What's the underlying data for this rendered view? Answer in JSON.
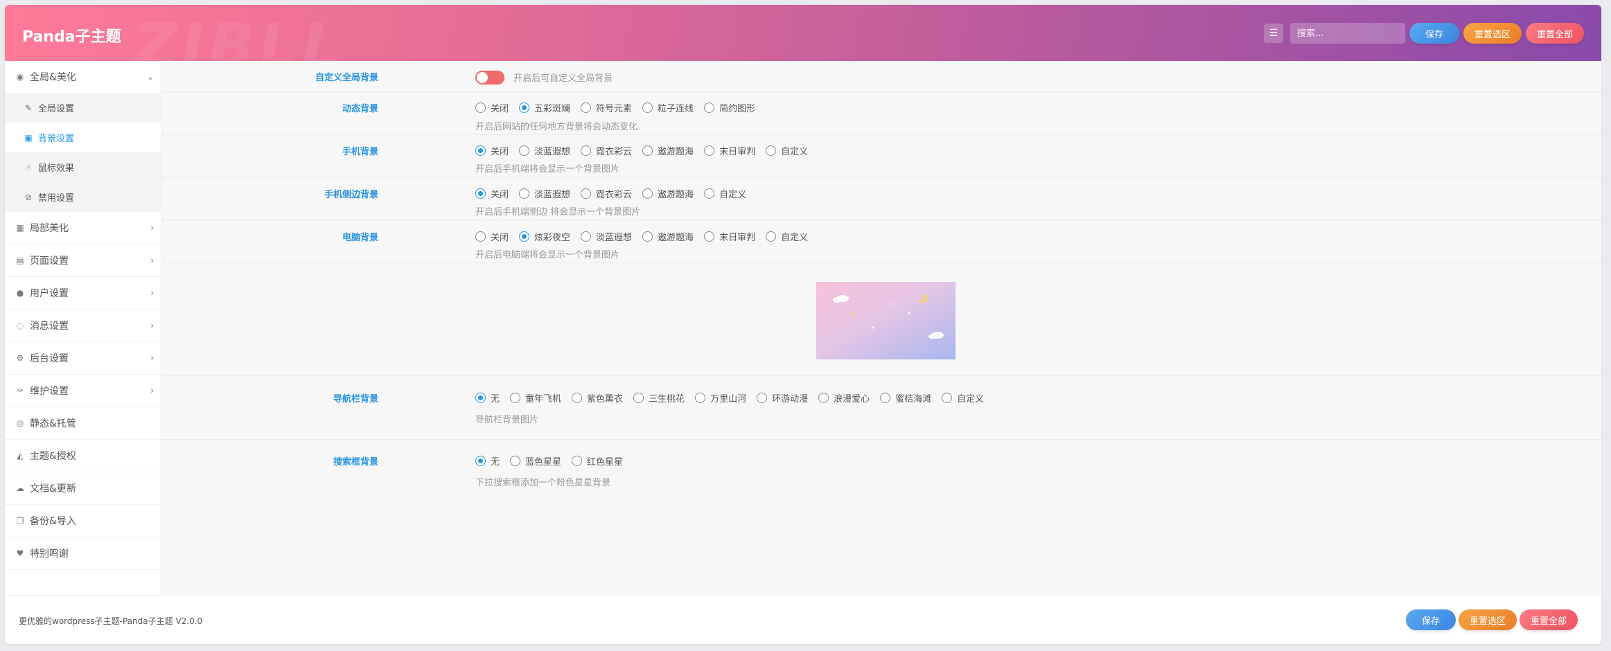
{
  "header": {
    "brand": "Panda子主题",
    "watermark": "ZIBLL",
    "search_placeholder": "搜索...",
    "save": "保存",
    "reset_section": "重置选区",
    "reset_all": "重置全部"
  },
  "sidebar": {
    "items": [
      {
        "label": "全局&美化",
        "icon": "circle-dot-icon",
        "expanded": true
      },
      {
        "label": "局部美化",
        "icon": "layout-icon"
      },
      {
        "label": "页面设置",
        "icon": "calendar-icon"
      },
      {
        "label": "用户设置",
        "icon": "user-icon"
      },
      {
        "label": "消息设置",
        "icon": "chat-icon"
      },
      {
        "label": "后台设置",
        "icon": "cogs-icon"
      },
      {
        "label": "维护设置",
        "icon": "wrench-icon"
      },
      {
        "label": "静态&托管",
        "icon": "eye-icon"
      },
      {
        "label": "主题&授权",
        "icon": "fox-icon"
      },
      {
        "label": "文档&更新",
        "icon": "cloud-upload-icon"
      },
      {
        "label": "备份&导入",
        "icon": "copy-icon"
      },
      {
        "label": "特别鸣谢",
        "icon": "heart-icon"
      }
    ],
    "sub_items": [
      {
        "label": "全局设置",
        "icon": "brush-icon"
      },
      {
        "label": "背景设置",
        "icon": "image-icon",
        "active": true
      },
      {
        "label": "鼠标效果",
        "icon": "hand-pointer-icon"
      },
      {
        "label": "禁用设置",
        "icon": "ban-icon"
      }
    ]
  },
  "settings": {
    "custom_bg": {
      "label": "自定义全局背景",
      "toggle_text": "开启后可自定义全局背景",
      "enabled": false
    },
    "dynamic_bg": {
      "label": "动态背景",
      "options": [
        "关闭",
        "五彩斑斓",
        "符号元素",
        "粒子连线",
        "简约图形"
      ],
      "selected": 1,
      "desc": "开启后网站的任何地方背景将会动态变化"
    },
    "mobile_bg": {
      "label": "手机背景",
      "options": [
        "关闭",
        "淡蓝遐想",
        "霓衣彩云",
        "遨游题海",
        "末日审判",
        "自定义"
      ],
      "selected": 0,
      "desc": "开启后手机端将会显示一个背景图片"
    },
    "mobile_side_bg": {
      "label": "手机侧边背景",
      "options": [
        "关闭",
        "淡蓝遐想",
        "霓衣彩云",
        "遨游题海",
        "自定义"
      ],
      "selected": 0,
      "desc": "开启后手机端侧边 将会显示一个背景图片"
    },
    "pc_bg": {
      "label": "电脑背景",
      "options": [
        "关闭",
        "炫彩夜空",
        "淡蓝遐想",
        "遨游题海",
        "末日审判",
        "自定义"
      ],
      "selected": 1,
      "desc": "开启后电脑端将会显示一个背景图片"
    },
    "nav_bg": {
      "label": "导航栏背景",
      "options": [
        "无",
        "童年飞机",
        "紫色薰衣",
        "三生桃花",
        "万里山河",
        "环游动漫",
        "浪漫爱心",
        "蜜桔海滩",
        "自定义"
      ],
      "selected": 0,
      "desc": "导航栏背景图片"
    },
    "search_bg": {
      "label": "搜索框背景",
      "options": [
        "无",
        "蓝色星星",
        "红色星星"
      ],
      "selected": 0,
      "desc": "下拉搜索框添加一个粉色星星背景"
    }
  },
  "footer": {
    "version_text": "更优雅的wordpress子主题-Panda子主题 V2.0.0",
    "save": "保存",
    "reset_section": "重置选区",
    "reset_all": "重置全部"
  },
  "colors": {
    "accent": "#2a95df",
    "toggle_off": "#ef6a6a",
    "header_start": "#ff7a98",
    "header_end": "#8a4aab"
  }
}
